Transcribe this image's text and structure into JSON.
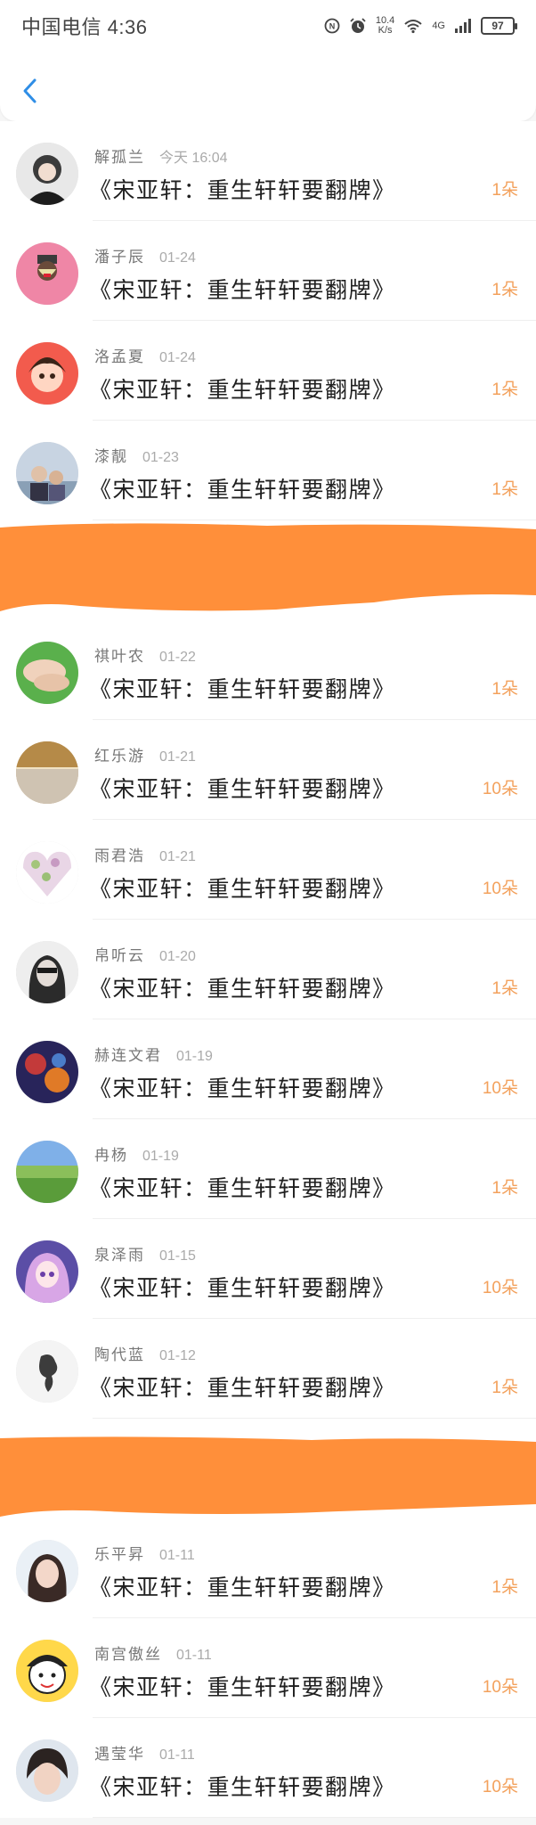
{
  "status_bar": {
    "carrier": "中国电信 4:36",
    "speed_value": "10.4",
    "speed_unit": "K/s",
    "network": "4G",
    "battery": "97"
  },
  "nav": {
    "back_icon": "chevron-left-icon"
  },
  "rows": [
    {
      "name": "解孤兰",
      "date": "今天 16:04",
      "title": "《宋亚轩：重生轩轩要翻牌》",
      "amount": "1朵"
    },
    {
      "name": "潘子辰",
      "date": "01-24",
      "title": "《宋亚轩：重生轩轩要翻牌》",
      "amount": "1朵"
    },
    {
      "name": "洛孟夏",
      "date": "01-24",
      "title": "《宋亚轩：重生轩轩要翻牌》",
      "amount": "1朵"
    },
    {
      "name": "漆靓",
      "date": "01-23",
      "title": "《宋亚轩：重生轩轩要翻牌》",
      "amount": "1朵"
    },
    {
      "name": "祺叶农",
      "date": "01-22",
      "title": "《宋亚轩：重生轩轩要翻牌》",
      "amount": "1朵"
    },
    {
      "name": "红乐游",
      "date": "01-21",
      "title": "《宋亚轩：重生轩轩要翻牌》",
      "amount": "10朵"
    },
    {
      "name": "雨君浩",
      "date": "01-21",
      "title": "《宋亚轩：重生轩轩要翻牌》",
      "amount": "10朵"
    },
    {
      "name": "帛听云",
      "date": "01-20",
      "title": "《宋亚轩：重生轩轩要翻牌》",
      "amount": "1朵"
    },
    {
      "name": "赫连文君",
      "date": "01-19",
      "title": "《宋亚轩：重生轩轩要翻牌》",
      "amount": "10朵"
    },
    {
      "name": "冉杨",
      "date": "01-19",
      "title": "《宋亚轩：重生轩轩要翻牌》",
      "amount": "1朵"
    },
    {
      "name": "泉泽雨",
      "date": "01-15",
      "title": "《宋亚轩：重生轩轩要翻牌》",
      "amount": "10朵"
    },
    {
      "name": "陶代蓝",
      "date": "01-12",
      "title": "《宋亚轩：重生轩轩要翻牌》",
      "amount": "1朵"
    },
    {
      "name": "乐平昇",
      "date": "01-11",
      "title": "《宋亚轩：重生轩轩要翻牌》",
      "amount": "1朵"
    },
    {
      "name": "南宫傲丝",
      "date": "01-11",
      "title": "《宋亚轩：重生轩轩要翻牌》",
      "amount": "10朵"
    },
    {
      "name": "遇莹华",
      "date": "01-11",
      "title": "《宋亚轩：重生轩轩要翻牌》",
      "amount": "10朵"
    }
  ],
  "colors": {
    "accent_amount": "#f3a15c",
    "redaction": "#ff8f3a",
    "back_icon": "#2f8ee6"
  }
}
